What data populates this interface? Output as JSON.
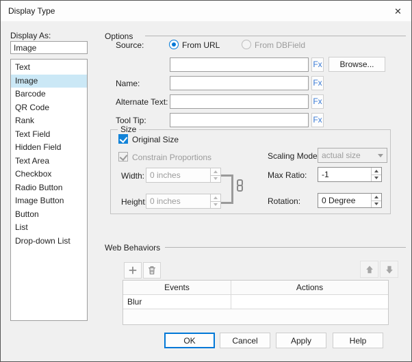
{
  "window": {
    "title": "Display Type",
    "close_glyph": "✕"
  },
  "colors": {
    "accent": "#0078d7",
    "selection": "#cbe8f6",
    "fx_text": "#3a7bd5",
    "disabled_text": "#9b9b9b",
    "dialog_bg": "#f0f0f0"
  },
  "icons": {
    "close": "x-mark",
    "add": "plus",
    "delete": "trash-can",
    "move_up": "arrow-up",
    "move_down": "arrow-down",
    "link": "chain-link",
    "dropdown": "caret-down",
    "spinner": "caret-up-down"
  },
  "sidebar": {
    "label": "Display As:",
    "value": "Image",
    "items": [
      {
        "label": "Text",
        "selected": false
      },
      {
        "label": "Image",
        "selected": true
      },
      {
        "label": "Barcode",
        "selected": false
      },
      {
        "label": "QR Code",
        "selected": false
      },
      {
        "label": "Rank",
        "selected": false
      },
      {
        "label": "Text Field",
        "selected": false
      },
      {
        "label": "Hidden Field",
        "selected": false
      },
      {
        "label": "Text Area",
        "selected": false
      },
      {
        "label": "Checkbox",
        "selected": false
      },
      {
        "label": "Radio Button",
        "selected": false
      },
      {
        "label": "Image Button",
        "selected": false
      },
      {
        "label": "Button",
        "selected": false
      },
      {
        "label": "List",
        "selected": false
      },
      {
        "label": "Drop-down List",
        "selected": false
      }
    ]
  },
  "options": {
    "section_label": "Options",
    "fx_label": "Fx",
    "browse_label": "Browse...",
    "source": {
      "label": "Source:",
      "radios": [
        {
          "label": "From URL",
          "selected": true,
          "enabled": true
        },
        {
          "label": "From DBField",
          "selected": false,
          "enabled": false
        }
      ],
      "url_value": ""
    },
    "fields": [
      {
        "label": "Name:",
        "value": ""
      },
      {
        "label": "Alternate Text:",
        "value": ""
      },
      {
        "label": "Tool Tip:",
        "value": ""
      }
    ],
    "size": {
      "section_label": "Size",
      "original_size": {
        "label": "Original Size",
        "checked": true,
        "enabled": true
      },
      "constrain": {
        "label": "Constrain Proportions",
        "checked": true,
        "enabled": false
      },
      "width": {
        "label": "Width:",
        "value": "0 inches",
        "enabled": false
      },
      "height": {
        "label": "Height:",
        "value": "0 inches",
        "enabled": false
      },
      "scaling_mode": {
        "label": "Scaling Mode:",
        "value": "actual size",
        "enabled": false
      },
      "max_ratio": {
        "label": "Max Ratio:",
        "value": "-1",
        "enabled": true
      },
      "rotation": {
        "label": "Rotation:",
        "value": "0 Degree",
        "enabled": true
      }
    }
  },
  "web_behaviors": {
    "section_label": "Web Behaviors",
    "table": {
      "headers": [
        "Events",
        "Actions"
      ],
      "rows": [
        {
          "event": "Blur",
          "action": ""
        }
      ]
    }
  },
  "footer": {
    "buttons": [
      {
        "label": "OK",
        "default": true
      },
      {
        "label": "Cancel",
        "default": false
      },
      {
        "label": "Apply",
        "default": false
      },
      {
        "label": "Help",
        "default": false
      }
    ]
  }
}
